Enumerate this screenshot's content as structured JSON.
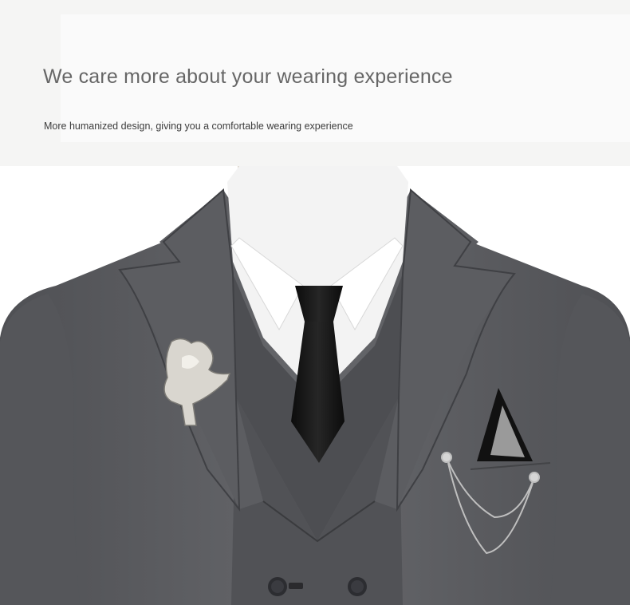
{
  "banner": {
    "headline": "We care more about your wearing experience",
    "subline": "More humanized design, giving you a comfortable wearing experience"
  },
  "photo": {
    "subject": "suit-mannequin",
    "colors": {
      "suit": "#5e5f63",
      "suit_shadow": "#46474b",
      "shirt": "#f4f4f4",
      "tie": "#141414",
      "mannequin": "#e9e3dc",
      "brooch": "#d9d6cf"
    }
  }
}
